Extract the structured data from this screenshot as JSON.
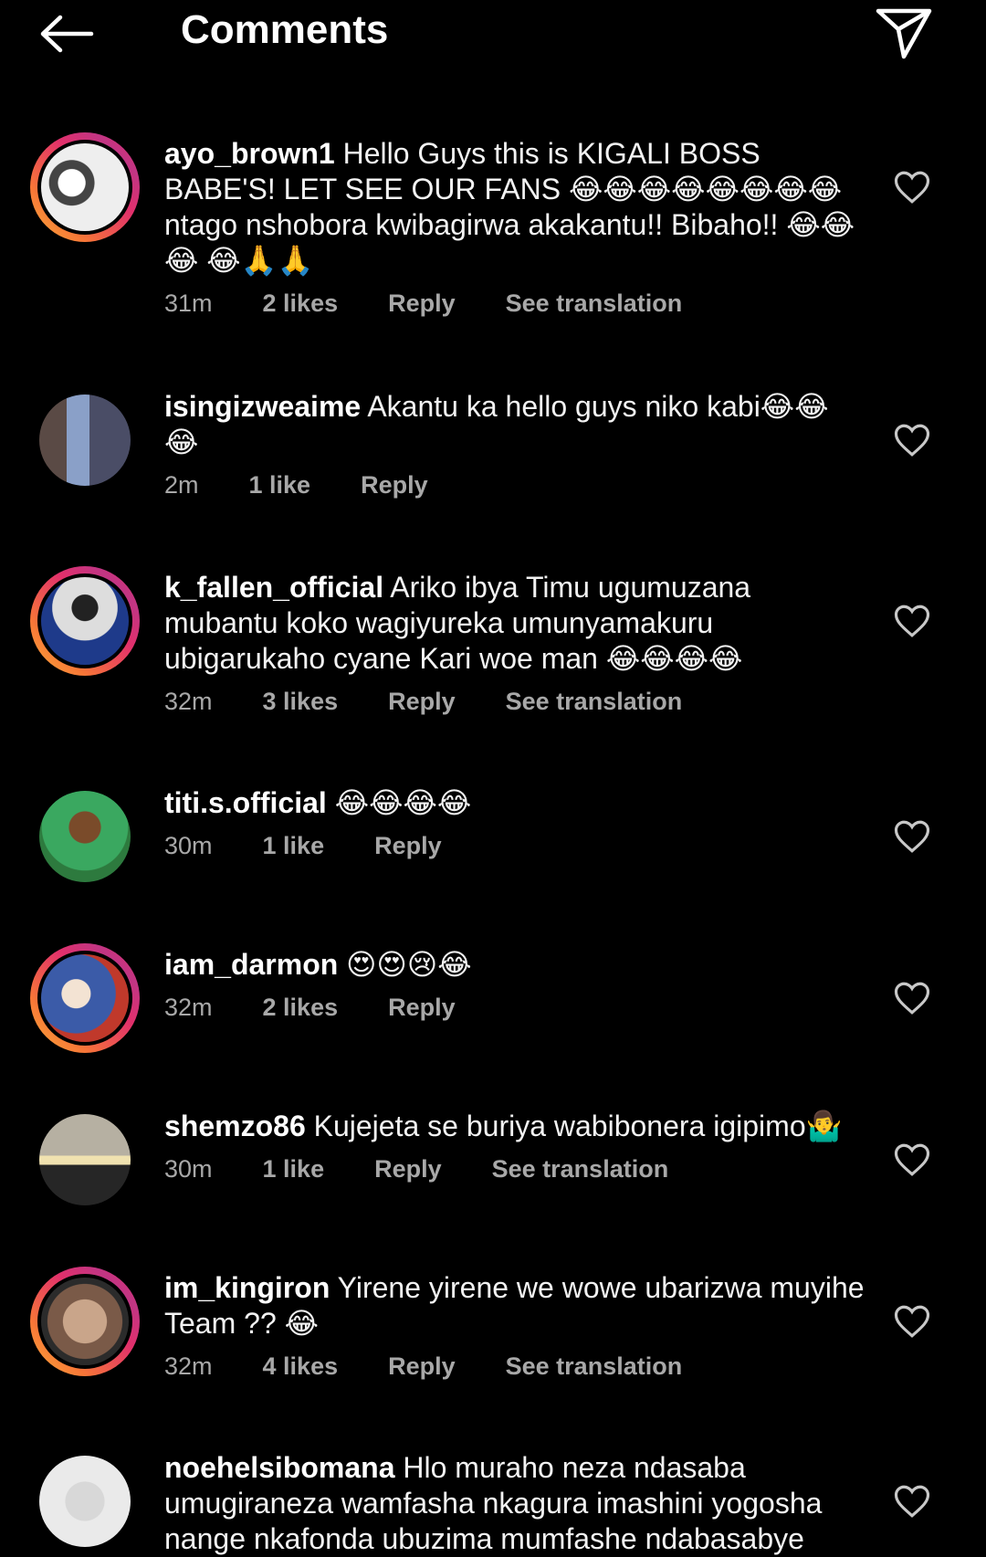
{
  "header": {
    "title": "Comments",
    "back_icon": "arrow-left-icon",
    "share_icon": "paper-plane-icon"
  },
  "comments": [
    {
      "username": "ayo_brown1",
      "text": "Hello Guys this is KIGALI BOSS BABE'S! LET SEE OUR FANS 😂😂😂😂😂😂😂😂 ntago nshobora kwibagirwa akakantu!! Bibaho!! 😂😂😂 😂🙏🙏",
      "time": "31m",
      "likes": "2 likes",
      "reply": "Reply",
      "translation": "See translation",
      "story_ring": true
    },
    {
      "username": "isingizweaime",
      "text": "Akantu ka hello guys niko kabi😂😂 😂",
      "time": "2m",
      "likes": "1 like",
      "reply": "Reply",
      "translation": "",
      "story_ring": false
    },
    {
      "username": "k_fallen_official",
      "text": "Ariko ibya Timu ugumuzana mubantu koko wagiyureka umunyamakuru ubigarukaho cyane Kari woe man 😂😂😂😂",
      "time": "32m",
      "likes": "3 likes",
      "reply": "Reply",
      "translation": "See translation",
      "story_ring": true
    },
    {
      "username": "titi.s.official",
      "text": "😂😂😂😂",
      "time": "30m",
      "likes": "1 like",
      "reply": "Reply",
      "translation": "",
      "story_ring": false
    },
    {
      "username": "iam_darmon",
      "text": "😍😍😢😂",
      "time": "32m",
      "likes": "2 likes",
      "reply": "Reply",
      "translation": "",
      "story_ring": true
    },
    {
      "username": "shemzo86",
      "text": "Kujejeta se buriya wabibonera igipimo🤷‍♂️",
      "time": "30m",
      "likes": "1 like",
      "reply": "Reply",
      "translation": "See translation",
      "story_ring": false
    },
    {
      "username": "im_kingiron",
      "text": "Yirene yirene we wowe ubarizwa muyihe Team ?? 😂",
      "time": "32m",
      "likes": "4 likes",
      "reply": "Reply",
      "translation": "See translation",
      "story_ring": true
    },
    {
      "username": "noehelsibomana",
      "text": "Hlo muraho neza ndasaba umugiraneza wamfasha nkagura imashini yogosha nange nkafonda ubuzima mumfashe ndabasabye",
      "time": "",
      "likes": "",
      "reply": "",
      "translation": "",
      "story_ring": false
    }
  ],
  "colors": {
    "background": "#000000",
    "text": "#f2f2f2",
    "meta": "#a8a8a8",
    "story_ring_start": "#fbb03b",
    "story_ring_end": "#c13584"
  }
}
